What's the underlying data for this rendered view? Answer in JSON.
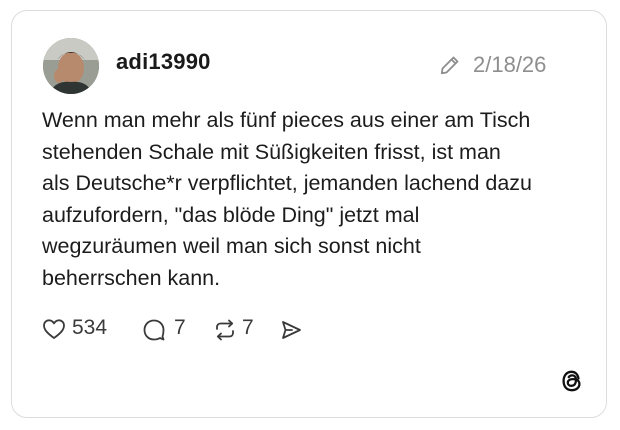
{
  "post": {
    "username": "adi13990",
    "date": "2/18/26",
    "text_lines": [
      "Wenn man mehr als fünf pieces aus einer am Tisch",
      "stehenden Schale mit Süßigkeiten frisst, ist man",
      "als Deutsche*r verpflichtet, jemanden lachend dazu",
      "aufzufordern, \"das blöde Ding\" jetzt mal",
      "wegzuräumen weil man sich sonst nicht",
      "beherrschen kann."
    ],
    "likes": "534",
    "comments": "7",
    "reposts": "7"
  },
  "icons": {
    "edit": "pencil-icon",
    "like": "heart-icon",
    "comment": "speech-bubble-icon",
    "repost": "repost-arrows-icon",
    "share": "send-icon",
    "brand": "threads-logo-icon"
  },
  "colors": {
    "text": "#1c1c1c",
    "muted": "#8e8e8e",
    "border": "#dcdcdc"
  }
}
